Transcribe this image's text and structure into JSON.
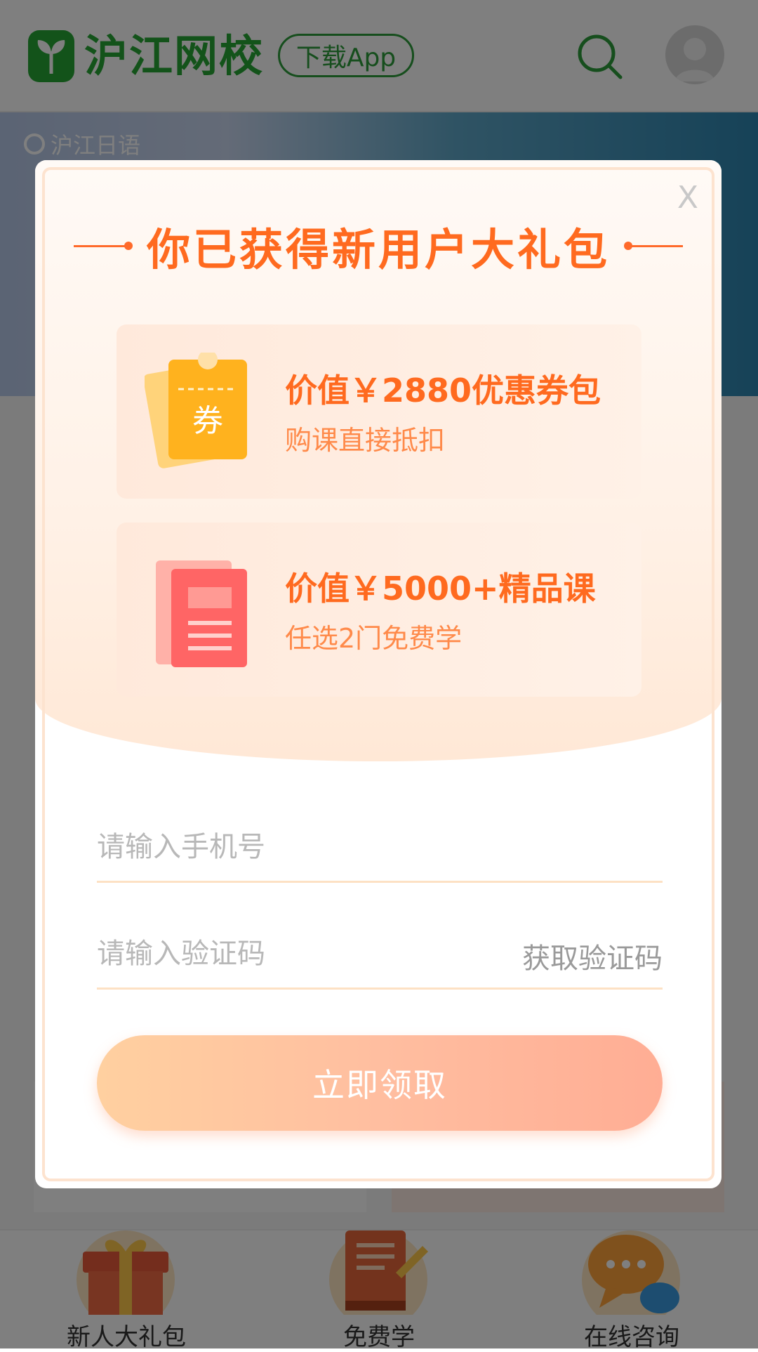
{
  "header": {
    "brand_name": "沪江网校",
    "download_label": "下载App"
  },
  "banner": {
    "logo_text": "沪江日语"
  },
  "bottom_nav": [
    {
      "label": "新人大礼包"
    },
    {
      "label": "免费学"
    },
    {
      "label": "在线咨询"
    }
  ],
  "modal": {
    "close_label": "X",
    "title": "你已获得新用户大礼包",
    "offers": [
      {
        "main": "价值￥2880优惠券包",
        "sub": "购课直接抵扣",
        "icon_text": "券"
      },
      {
        "main": "价值￥5000+精品课",
        "sub": "任选2门免费学"
      }
    ],
    "phone_placeholder": "请输入手机号",
    "code_placeholder": "请输入验证码",
    "get_code_label": "获取验证码",
    "submit_label": "立即领取"
  },
  "colors": {
    "brand_green": "#27a634",
    "accent_orange": "#ff6a1f",
    "button_gradient_start": "#ffd0a0",
    "button_gradient_end": "#ffad94"
  }
}
